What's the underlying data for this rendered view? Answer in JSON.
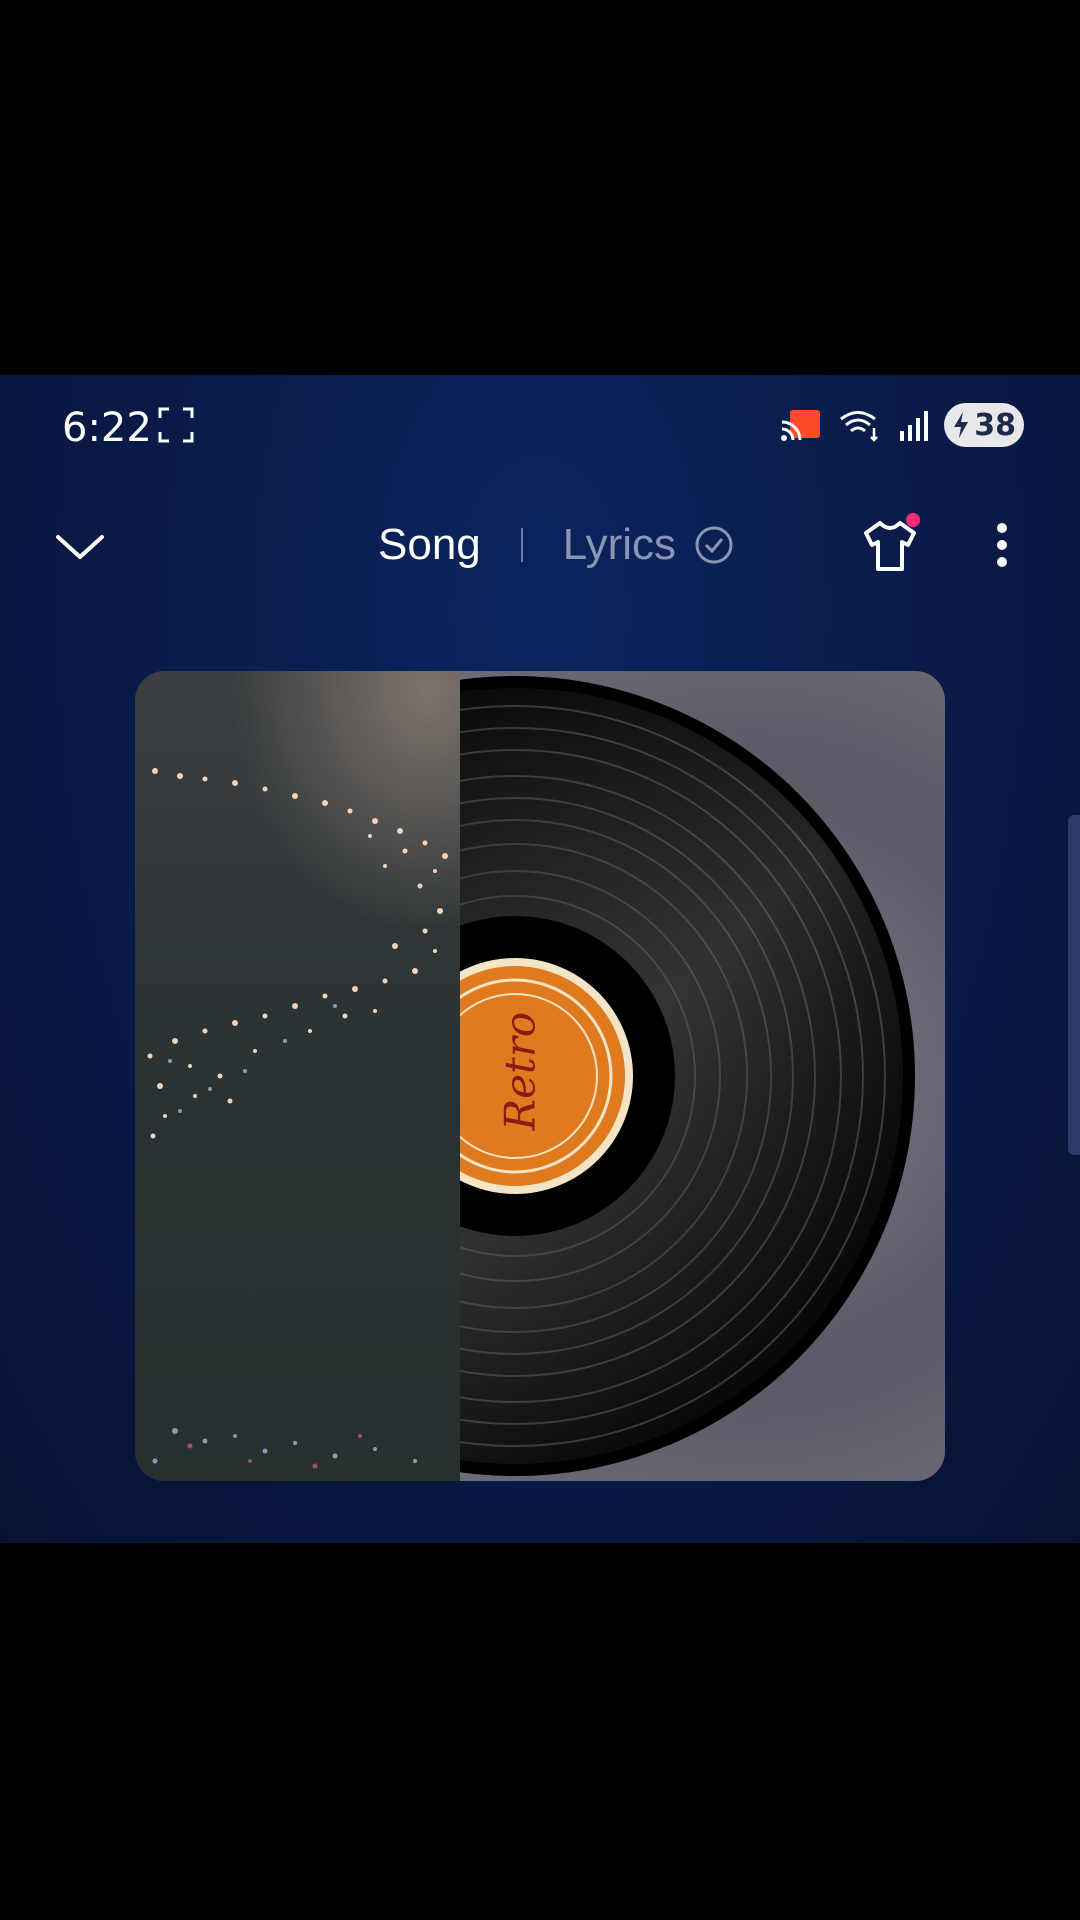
{
  "status_bar": {
    "time": "6:22",
    "battery": "38",
    "icons": [
      "fullscreen-icon",
      "cast-icon",
      "wifi-icon",
      "signal-icon",
      "battery-charging-icon"
    ]
  },
  "nav": {
    "collapse_icon": "chevron-down-icon",
    "tab_song": "Song",
    "tab_lyrics": "Lyrics",
    "lyrics_status_icon": "check-circle-icon",
    "theme_icon": "tshirt-icon",
    "more_icon": "more-vertical-icon"
  },
  "album": {
    "label_text": "Retro",
    "colors": {
      "label": "#e07a1f",
      "vinyl": "#0d0d0d",
      "accent_dot": "#ff2a7a"
    }
  }
}
